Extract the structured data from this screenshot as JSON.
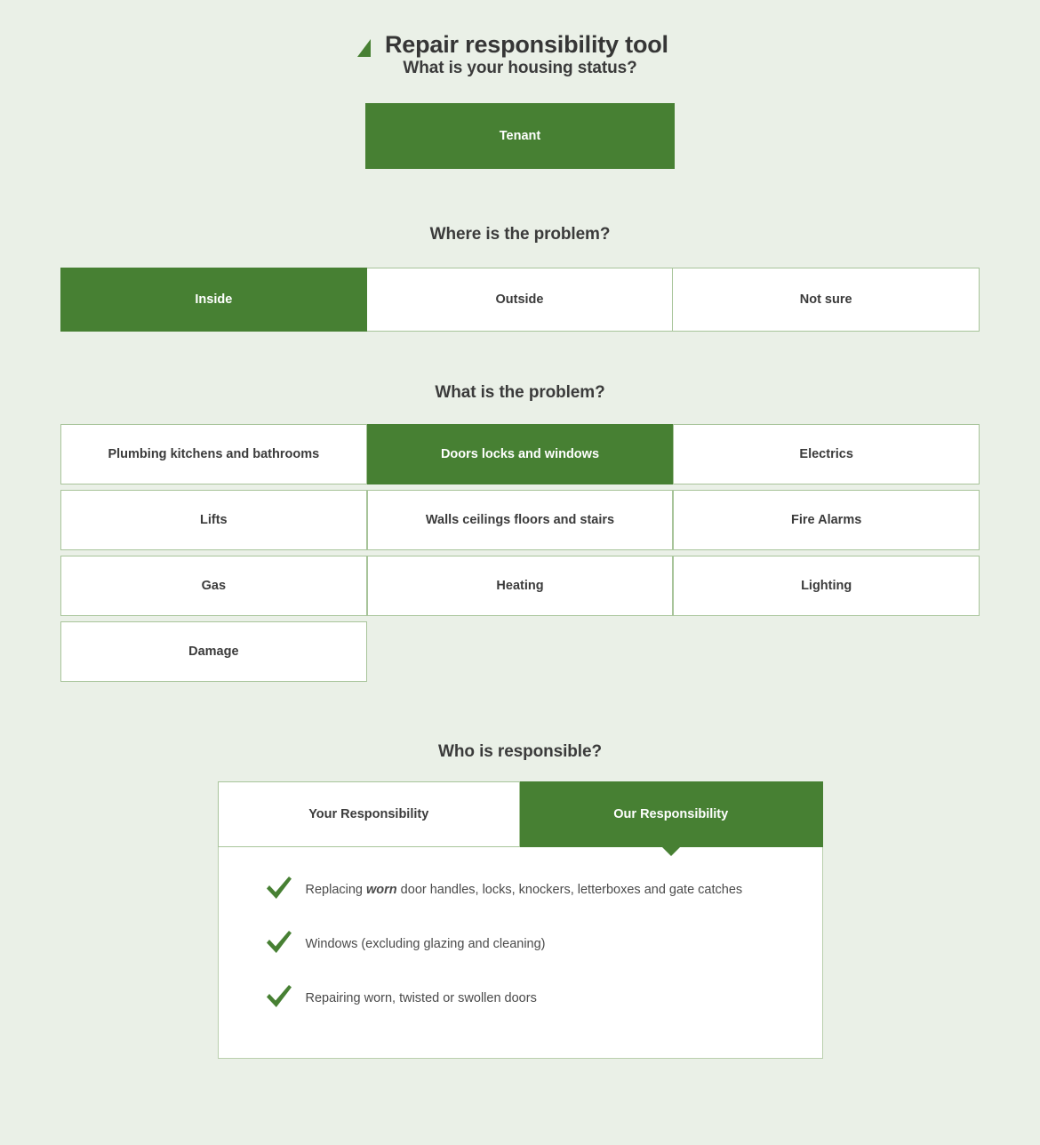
{
  "title": {
    "text": "Repair responsibility tool",
    "icon": "triangle-flag-icon"
  },
  "colors": {
    "accent_green": "#478033",
    "page_background": "#eaf0e7",
    "border_green": "#a8c49a",
    "heading_text": "#3b3b3b"
  },
  "housing_status": {
    "heading": "What is your housing status?",
    "options": [
      {
        "label": "Tenant",
        "selected": true
      }
    ]
  },
  "problem_location": {
    "heading": "Where is the problem?",
    "options": [
      {
        "label": "Inside",
        "selected": true
      },
      {
        "label": "Outside",
        "selected": false
      },
      {
        "label": "Not sure",
        "selected": false
      }
    ]
  },
  "problem_type": {
    "heading": "What is the problem?",
    "options": [
      {
        "label": "Plumbing kitchens and bathrooms",
        "selected": false
      },
      {
        "label": "Doors locks and windows",
        "selected": true
      },
      {
        "label": "Electrics",
        "selected": false
      },
      {
        "label": "Lifts",
        "selected": false
      },
      {
        "label": "Walls ceilings floors and stairs",
        "selected": false
      },
      {
        "label": "Fire Alarms",
        "selected": false
      },
      {
        "label": "Gas",
        "selected": false
      },
      {
        "label": "Heating",
        "selected": false
      },
      {
        "label": "Lighting",
        "selected": false
      },
      {
        "label": "Damage",
        "selected": false
      }
    ]
  },
  "responsibility": {
    "heading": "Who is responsible?",
    "tabs": [
      {
        "label": "Your Responsibility",
        "active": false
      },
      {
        "label": "Our Responsibility",
        "active": true
      }
    ],
    "items": [
      {
        "icon": "check-icon",
        "before": "Replacing ",
        "emphasis": "worn",
        "after": " door handles, locks, knockers, letterboxes and gate catches"
      },
      {
        "icon": "check-icon",
        "before": "Windows (excluding glazing and cleaning)",
        "emphasis": "",
        "after": ""
      },
      {
        "icon": "check-icon",
        "before": "Repairing worn, twisted or swollen doors",
        "emphasis": "",
        "after": ""
      }
    ]
  }
}
